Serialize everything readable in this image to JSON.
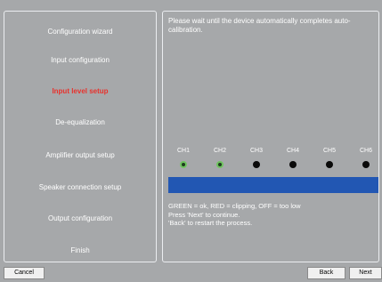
{
  "sidebar": {
    "items": [
      {
        "label": "Configuration wizard"
      },
      {
        "label": "Input configuration"
      },
      {
        "label": "Input level setup"
      },
      {
        "label": "De-equalization"
      },
      {
        "label": "Amplifier output setup"
      },
      {
        "label": "Speaker connection setup"
      },
      {
        "label": "Output configuration"
      },
      {
        "label": "Finish"
      }
    ],
    "active_index": 2
  },
  "main": {
    "instruction": "Please wait until the device automatically completes auto-calibration.",
    "channels": [
      {
        "label": "CH1",
        "status": "green"
      },
      {
        "label": "CH2",
        "status": "green"
      },
      {
        "label": "CH3",
        "status": "off"
      },
      {
        "label": "CH4",
        "status": "off"
      },
      {
        "label": "CH5",
        "status": "off"
      },
      {
        "label": "CH6",
        "status": "off"
      }
    ],
    "legend": {
      "line1": "GREEN = ok, RED = clipping, OFF = too low",
      "line2": "Press 'Next' to continue.",
      "line3": "'Back' to restart the process."
    }
  },
  "buttons": {
    "cancel": "Cancel",
    "back": "Back",
    "next": "Next"
  },
  "colors": {
    "background": "#a6a8aa",
    "active_item": "#e8322d",
    "level_bar": "#2257b3",
    "led_ok": "#6fc35f"
  }
}
